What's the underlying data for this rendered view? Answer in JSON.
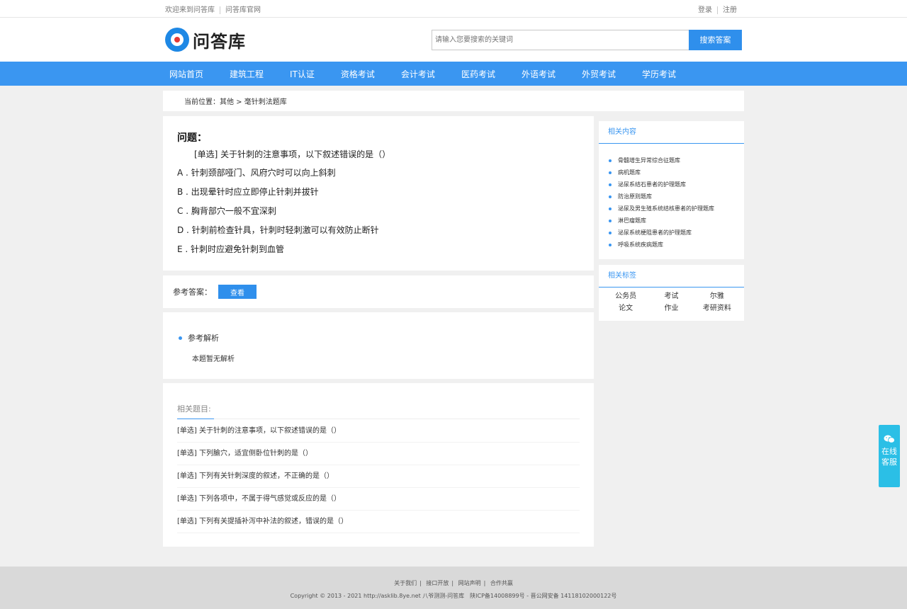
{
  "topbar": {
    "welcome": "欢迎来到问答库",
    "official": "问答库官网",
    "login": "登录",
    "register": "注册"
  },
  "header": {
    "logo_text": "问答库",
    "search_placeholder": "请输入您要搜索的关键词",
    "search_button": "搜索答案"
  },
  "nav": {
    "items": [
      "网站首页",
      "建筑工程",
      "IT认证",
      "资格考试",
      "会计考试",
      "医药考试",
      "外语考试",
      "外贸考试",
      "学历考试"
    ]
  },
  "breadcrumb": {
    "text": "当前位置：其他 > 毫针刺法题库"
  },
  "question": {
    "title": "问题：",
    "stem": "[单选] 关于针刺的注意事项，以下叙述错误的是（）",
    "options": [
      "A . 针刺颈部哑门、风府穴时可以向上斜刺",
      "B . 出现晕针时应立即停止针刺并拔针",
      "C . 胸背部穴一般不宜深刺",
      "D . 针刺前检查针具，针刺时轻刺激可以有效防止断针",
      "E . 针刺时应避免针刺到血管"
    ]
  },
  "answer": {
    "label": "参考答案：",
    "button": "查看"
  },
  "analysis": {
    "heading": "参考解析",
    "body": "本题暂无解析"
  },
  "related_questions": {
    "heading": "相关题目:",
    "items": [
      "[单选] 关于针刺的注意事项，以下叙述错误的是（）",
      "[单选] 下列腧穴，适宜侧卧位针刺的是（）",
      "[单选] 下列有关针刺深度的叙述，不正确的是（）",
      "[单选] 下列各项中，不属于得气感觉或反应的是（）",
      "[单选] 下列有关提插补泻中补法的叙述，错误的是（）"
    ]
  },
  "side_related": {
    "heading": "相关内容",
    "items": [
      "骨髓增生异常综合征题库",
      "病机题库",
      "泌尿系结石患者的护理题库",
      "防治原则题库",
      "泌尿及男生殖系统结核患者的护理题库",
      "淋巴瘤题库",
      "泌尿系统梗阻患者的护理题库",
      "呼吸系统疾病题库"
    ]
  },
  "side_tags": {
    "heading": "相关标签",
    "items": [
      "公务员",
      "考试",
      "尔雅",
      "论文",
      "作业",
      "考研资料"
    ]
  },
  "footer": {
    "links": [
      "关于我们",
      "接口开放",
      "网站声明",
      "合作共赢"
    ],
    "copyright": "Copyright © 2013 - 2021 http://asklib.8ye.net 八爷测测-问答库　陕ICP备14008899号 - 晋公网安备 14118102000122号"
  },
  "service": {
    "line1": "在线",
    "line2": "客服"
  },
  "colors": {
    "primary": "#3a96f1",
    "button": "#2f8fec",
    "service": "#2bbfe6"
  }
}
